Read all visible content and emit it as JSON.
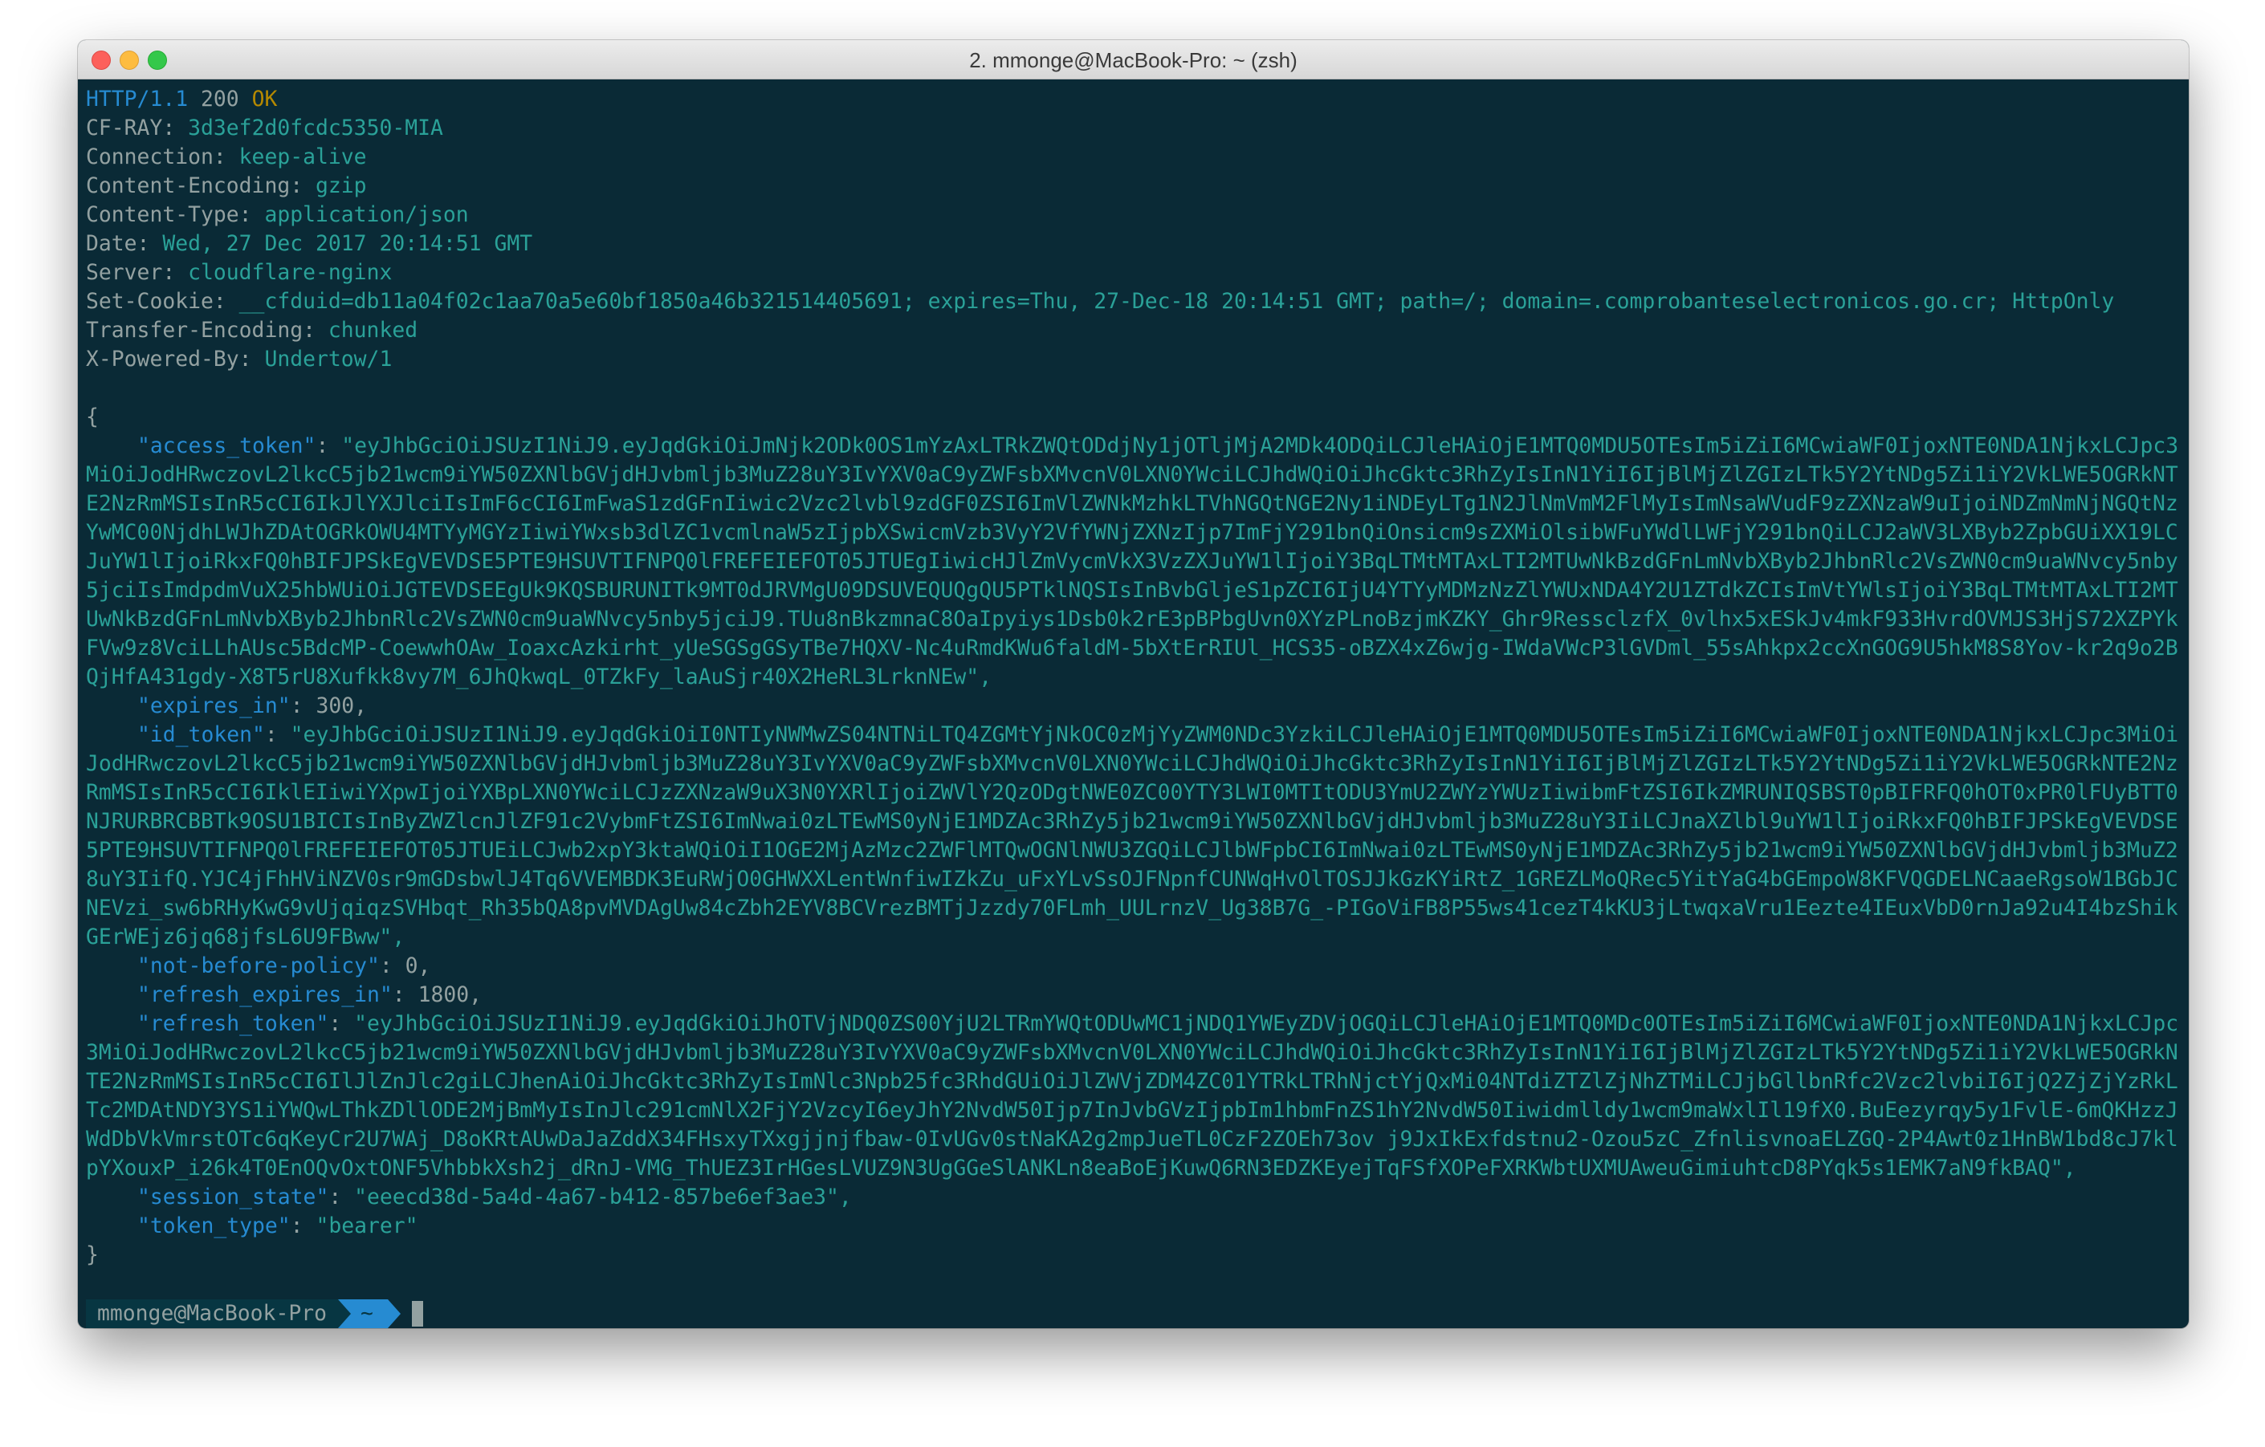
{
  "window": {
    "title": "2. mmonge@MacBook-Pro: ~ (zsh)"
  },
  "http": {
    "protocol": "HTTP/1.1",
    "code": "200",
    "reason": "OK"
  },
  "headers": [
    {
      "name": "CF-RAY:",
      "value": "3d3ef2d0fcdc5350-MIA"
    },
    {
      "name": "Connection:",
      "value": "keep-alive"
    },
    {
      "name": "Content-Encoding:",
      "value": "gzip"
    },
    {
      "name": "Content-Type:",
      "value": "application/json"
    },
    {
      "name": "Date:",
      "value": "Wed, 27 Dec 2017 20:14:51 GMT"
    },
    {
      "name": "Server:",
      "value": "cloudflare-nginx"
    },
    {
      "name": "Set-Cookie:",
      "value": "__cfduid=db11a04f02c1aa70a5e60bf1850a46b321514405691; expires=Thu, 27-Dec-18 20:14:51 GMT; path=/; domain=.comprobanteselectronicos.go.cr; HttpOnly"
    },
    {
      "name": "Transfer-Encoding:",
      "value": "chunked"
    },
    {
      "name": "X-Powered-By:",
      "value": "Undertow/1"
    }
  ],
  "json": {
    "open_brace": "{",
    "close_brace": "}",
    "access_token_key": "\"access_token\"",
    "access_token_value": "\"eyJhbGciOiJSUzI1NiJ9.eyJqdGkiOiJmNjk2ODk0OS1mYzAxLTRkZWQtODdjNy1jOTljMjA2MDk4ODQiLCJleHAiOjE1MTQ0MDU5OTEsIm5iZiI6MCwiaWF0IjoxNTE0NDA1NjkxLCJpc3MiOiJodHRwczovL2lkcC5jb21wcm9iYW50ZXNlbGVjdHJvbmljb3MuZ28uY3IvYXV0aC9yZWFsbXMvcnV0LXN0YWciLCJhdWQiOiJhcGktc3RhZyIsInN1YiI6IjBlMjZlZGIzLTk5Y2YtNDg5Zi1iY2VkLWE5OGRkNTE2NzRmMSIsInR5cCI6IkJlYXJlciIsImF6cCI6ImFwaS1zdGFnIiwic2Vzc2lvbl9zdGF0ZSI6ImVlZWNkMzhkLTVhNGQtNGE2Ny1iNDEyLTg1N2JlNmVmM2FlMyIsImNsaWVudF9zZXNzaW9uIjoiNDZmNmNjNGQtNzYwMC00NjdhLWJhZDAtOGRkOWU4MTYyMGYzIiwiYWxsb3dlZC1vcmlnaW5zIjpbXSwicmVzb3VyY2VfYWNjZXNzIjp7ImFjY291bnQiOnsicm9sZXMiOlsibWFuYWdlLWFjY291bnQiLCJ2aWV3LXByb2ZpbGUiXX19LCJuYW1lIjoiRkxFQ0hBIFJPSkEgVEVDSE5PTE9HSUVTIFNPQ0lFREFEIEFOT05JTUEgIiwicHJlZmVycmVkX3VzZXJuYW1lIjoiY3BqLTMtMTAxLTI2MTUwNkBzdGFnLmNvbXByb2JhbnRlc2VsZWN0cm9uaWNvcy5nby5jciIsImdpdmVuX25hbWUiOiJGTEVDSEEgUk9KQSBURUNITk9MT0dJRVMgU09DSUVEQUQgQU5PTklNQSIsInBvbGljeS1pZCI6IjU4YTYyMDMzNzZlYWUxNDA4Y2U1ZTdkZCIsImVtYWlsIjoiY3BqLTMtMTAxLTI2MTUwNkBzdGFnLmNvbXByb2JhbnRlc2VsZWN0cm9uaWNvcy5nby5jciJ9.TUu8nBkzmnaC8OaIpyiys1Dsb0k2rE3pBPbgUvn0XYzPLnoBzjmKZKY_Ghr9RessclzfX_0vlhx5xESkJv4mkF933HvrdOVMJS3HjS72XZPYkFVw9z8VciLLhAUsc5BdcMP-CoewwhOAw_IoaxcAzkirht_yUeSGSgGSyTBe7HQXV-Nc4uRmdKWu6faldM-5bXtErRIUl_HCS35-oBZX4xZ6wjg-IWdaVWcP3lGVDml_55sAhkpx2ccXnGOG9U5hkM8S8Yov-kr2q9o2BQjHfA431gdy-X8T5rU8Xufkk8vy7M_6JhQkwqL_0TZkFy_laAuSjr40X2HeRL3LrknNEw\",",
    "expires_in_key": "\"expires_in\"",
    "expires_in_value": "300,",
    "id_token_key": "\"id_token\"",
    "id_token_value": "\"eyJhbGciOiJSUzI1NiJ9.eyJqdGkiOiI0NTIyNWMwZS04NTNiLTQ4ZGMtYjNkOC0zMjYyZWM0NDc3YzkiLCJleHAiOjE1MTQ0MDU5OTEsIm5iZiI6MCwiaWF0IjoxNTE0NDA1NjkxLCJpc3MiOiJodHRwczovL2lkcC5jb21wcm9iYW50ZXNlbGVjdHJvbmljb3MuZ28uY3IvYXV0aC9yZWFsbXMvcnV0LXN0YWciLCJhdWQiOiJhcGktc3RhZyIsInN1YiI6IjBlMjZlZGIzLTk5Y2YtNDg5Zi1iY2VkLWE5OGRkNTE2NzRmMSIsInR5cCI6IklEIiwiYXpwIjoiYXBpLXN0YWciLCJzZXNzaW9uX3N0YXRlIjoiZWVlY2QzODgtNWE0ZC00YTY3LWI0MTItODU3YmU2ZWYzYWUzIiwibmFtZSI6IkZMRUNIQSBST0pBIFRFQ0hOT0xPR0lFUyBTT0NJRURBRCBBTk9OSU1BICIsInByZWZlcnJlZF91c2VybmFtZSI6ImNwai0zLTEwMS0yNjE1MDZAc3RhZy5jb21wcm9iYW50ZXNlbGVjdHJvbmljb3MuZ28uY3IiLCJnaXZlbl9uYW1lIjoiRkxFQ0hBIFJPSkEgVEVDSE5PTE9HSUVTIFNPQ0lFREFEIEFOT05JTUEiLCJwb2xpY3ktaWQiOiI1OGE2MjAzMzc2ZWFlMTQwOGNlNWU3ZGQiLCJlbWFpbCI6ImNwai0zLTEwMS0yNjE1MDZAc3RhZy5jb21wcm9iYW50ZXNlbGVjdHJvbmljb3MuZ28uY3IifQ.YJC4jFhHViNZV0sr9mGDsbwlJ4Tq6VVEMBDK3EuRWjO0GHWXXLentWnfiwIZkZu_uFxYLvSsOJFNpnfCUNWqHvOlTOSJJkGzKYiRtZ_1GREZLMoQRec5YitYaG4bGEmpoW8KFVQGDELNCaaeRgsoW1BGbJCNEVzi_sw6bRHyKwG9vUjqiqzSVHbqt_Rh35bQA8pvMVDAgUw84cZbh2EYV8BCVrezBMTjJzzdy70FLmh_UULrnzV_Ug38B7G_-PIGoViFB8P55ws41cezT4kKU3jLtwqxaVru1Eezte4IEuxVbD0rnJa92u4I4bzShikGErWEjz6jq68jfsL6U9FBww\",",
    "not_before_policy_key": "\"not-before-policy\"",
    "not_before_policy_value": "0,",
    "refresh_expires_in_key": "\"refresh_expires_in\"",
    "refresh_expires_in_value": "1800,",
    "refresh_token_key": "\"refresh_token\"",
    "refresh_token_value": "\"eyJhbGciOiJSUzI1NiJ9.eyJqdGkiOiJhOTVjNDQ0ZS00YjU2LTRmYWQtODUwMC1jNDQ1YWEyZDVjOGQiLCJleHAiOjE1MTQ0MDc0OTEsIm5iZiI6MCwiaWF0IjoxNTE0NDA1NjkxLCJpc3MiOiJodHRwczovL2lkcC5jb21wcm9iYW50ZXNlbGVjdHJvbmljb3MuZ28uY3IvYXV0aC9yZWFsbXMvcnV0LXN0YWciLCJhdWQiOiJhcGktc3RhZyIsInN1YiI6IjBlMjZlZGIzLTk5Y2YtNDg5Zi1iY2VkLWE5OGRkNTE2NzRmMSIsInR5cCI6IlJlZnJlc2giLCJhenAiOiJhcGktc3RhZyIsImNlc3Npb25fc3RhdGUiOiJlZWVjZDM4ZC01YTRkLTRhNjctYjQxMi04NTdiZTZlZjNhZTMiLCJjbGllbnRfc2Vzc2lvbiI6IjQ2ZjZjYzRkLTc2MDAtNDY3YS1iYWQwLThkZDllODE2MjBmMyIsInJlc291cmNlX2FjY2VzcyI6eyJhY2NvdW50Ijp7InJvbGVzIjpbIm1hbmFnZS1hY2NvdW50Iiwidmlldy1wcm9maWxlIl19fX0.BuEezyrqy5y1FvlE-6mQKHzzJWdDbVkVmrstOTc6qKeyCr2U7WAj_D8oKRtAUwDaJaZddX34FHsxyTXxgjjnjfbaw-0IvUGv0stNaKA2g2mpJueTL0CzF2ZOEh73ov j9JxIkExfdstnu2-Ozou5zC_ZfnlisvnoaELZGQ-2P4Awt0z1HnBW1bd8cJ7klpYXouxP_i26k4T0EnOQvOxtONF5VhbbkXsh2j_dRnJ-VMG_ThUEZ3IrHGesLVUZ9N3UgGGeSlANKLn8eaBoEjKuwQ6RN3EDZKEyejTqFSfXOPeFXRKWbtUXMUAweuGimiuhtcD8PYqk5s1EMK7aN9fkBAQ\",",
    "session_state_key": "\"session_state\"",
    "session_state_value": "\"eeecd38d-5a4d-4a67-b412-857be6ef3ae3\",",
    "token_type_key": "\"token_type\"",
    "token_type_value": "\"bearer\""
  },
  "prompt": {
    "user": "mmonge@MacBook-Pro",
    "dir": "~"
  }
}
